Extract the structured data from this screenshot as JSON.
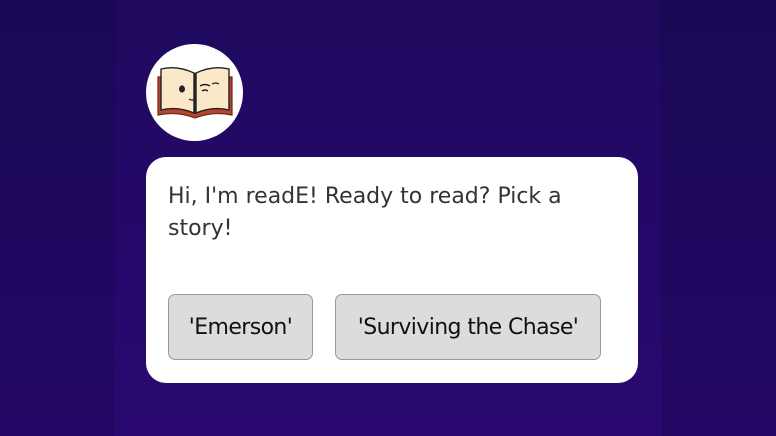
{
  "assistant": {
    "avatar_icon": "open-book-face-icon",
    "message": "Hi, I'm readE! Ready to read? Pick a story!"
  },
  "choices": [
    {
      "label": "'Emerson'"
    },
    {
      "label": "'Surviving the Chase'"
    }
  ],
  "colors": {
    "background": "#22086a",
    "card": "#ffffff",
    "button": "#dcdcdc",
    "book_page": "#fbe8c8",
    "book_cover": "#b8442e"
  }
}
